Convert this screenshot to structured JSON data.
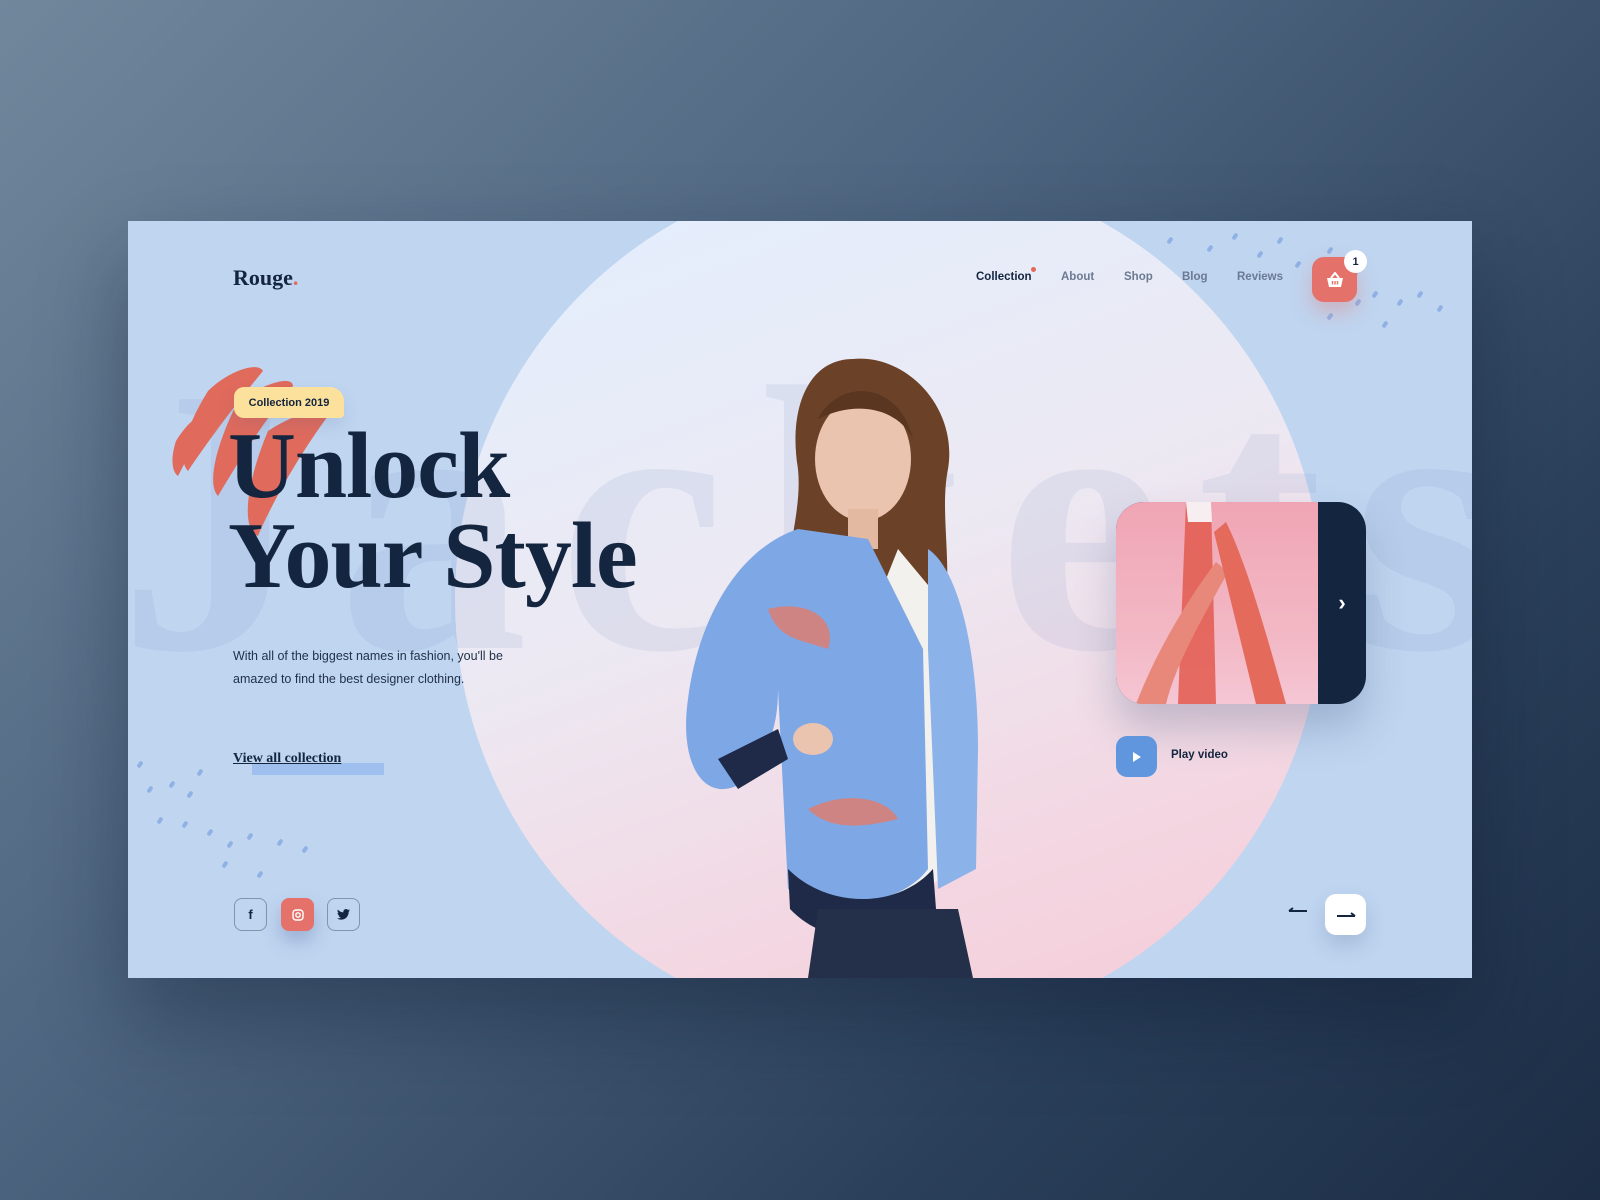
{
  "brand": {
    "name": "Rouge",
    "dot": ".",
    "accent": "#e4685b"
  },
  "nav": {
    "items": [
      {
        "label": "Collection",
        "active": true
      },
      {
        "label": "About"
      },
      {
        "label": "Shop"
      },
      {
        "label": "Blog"
      },
      {
        "label": "Reviews"
      }
    ]
  },
  "cart": {
    "icon": "basket-icon",
    "count": "1"
  },
  "background_word": "Jackets",
  "hero": {
    "tag": "Collection 2019",
    "title_line1": "Unlock",
    "title_line2": "Your Style",
    "description": "With all of the biggest names in fashion, you'll be amazed to find the best designer clothing.",
    "cta": "View all collection"
  },
  "social": [
    {
      "icon": "facebook-icon",
      "glyph": "f"
    },
    {
      "icon": "instagram-icon",
      "active": true
    },
    {
      "icon": "twitter-icon"
    }
  ],
  "video": {
    "play_label": "Play video",
    "next_icon": "chevron-right-icon"
  },
  "slider": {
    "prev_icon": "arrow-left-icon",
    "next_icon": "arrow-right-icon"
  },
  "colors": {
    "background": "#bfd5f0",
    "navy": "#13253f",
    "coral": "#e4716a",
    "yellow": "#fbe19c",
    "blue": "#5f96de"
  }
}
